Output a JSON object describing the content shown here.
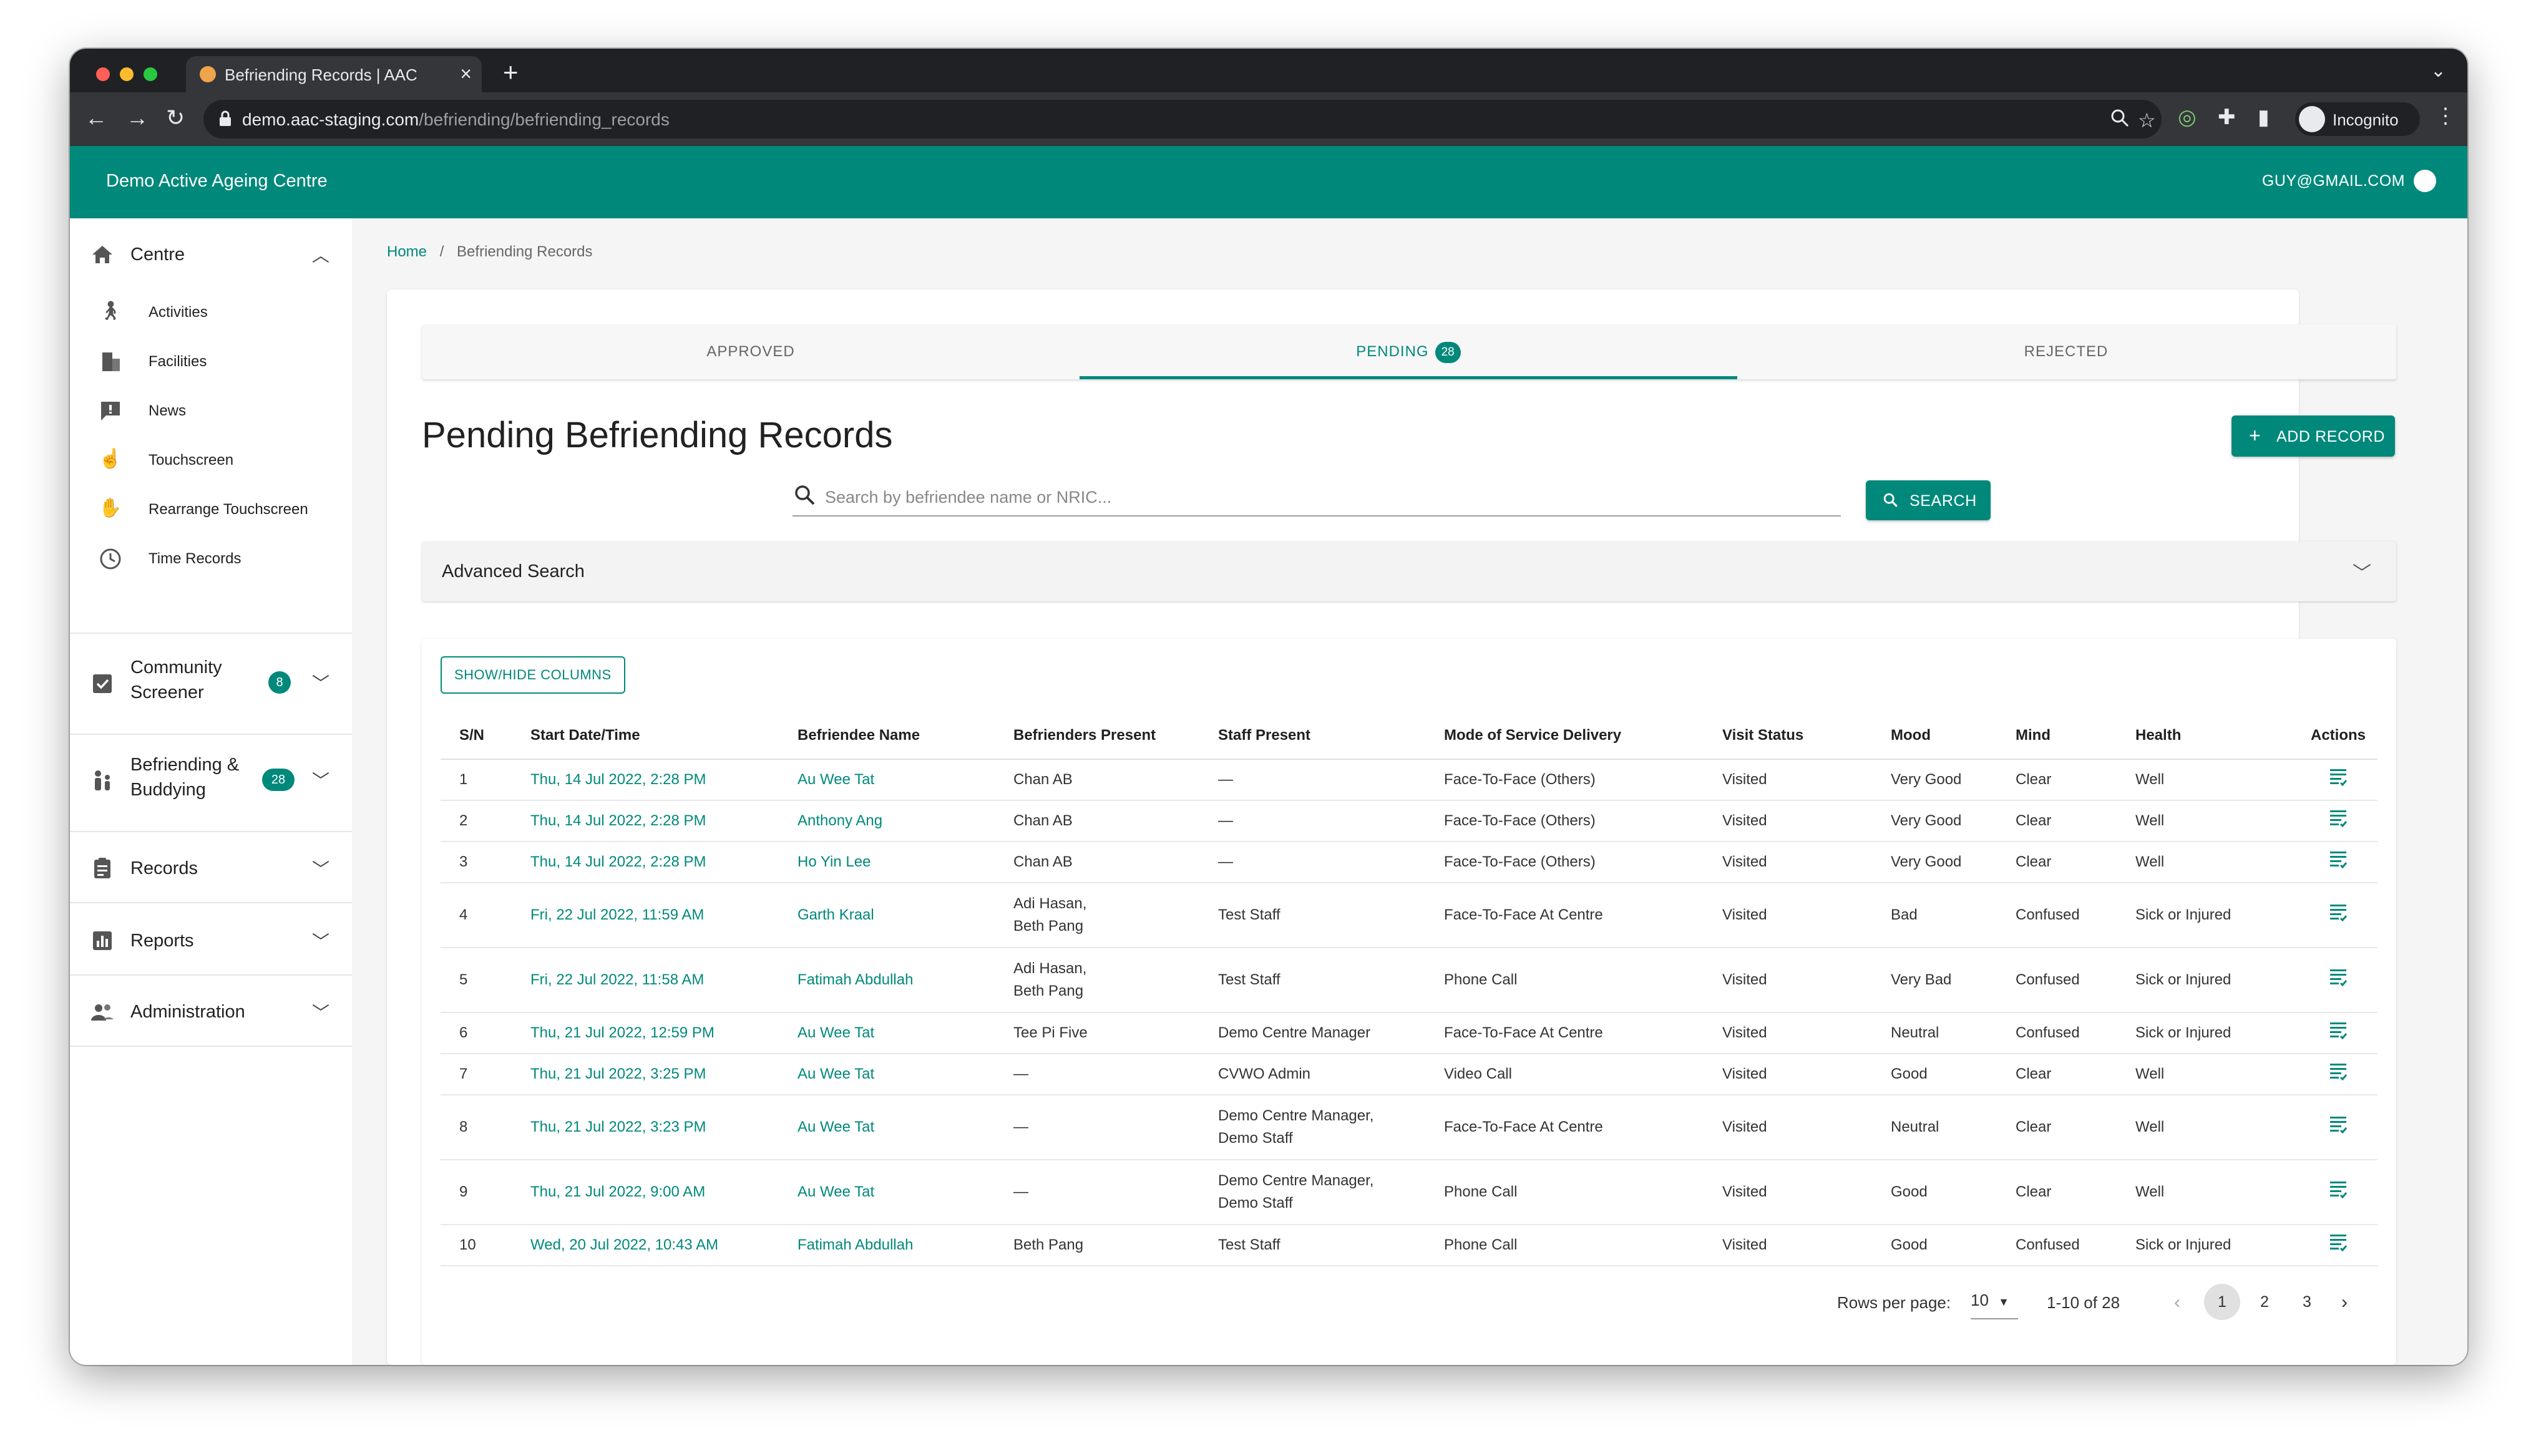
{
  "browser": {
    "tab_title": "Befriending Records | AAC",
    "url_host": "demo.aac-staging.com",
    "url_path": "/befriending/befriending_records",
    "profile_label": "Incognito"
  },
  "app": {
    "brand": "Demo Active Ageing Centre",
    "user_email": "GUY@GMAIL.COM"
  },
  "sidebar": {
    "centre_label": "Centre",
    "items": [
      "Activities",
      "Facilities",
      "News",
      "Touchscreen",
      "Rearrange Touchscreen",
      "Time Records"
    ],
    "community_label_1": "Community",
    "community_label_2": "Screener",
    "community_badge": "8",
    "befriending_label_1": "Befriending &",
    "befriending_label_2": "Buddying",
    "befriending_badge": "28",
    "records_label": "Records",
    "reports_label": "Reports",
    "admin_label": "Administration"
  },
  "breadcrumb": {
    "home": "Home",
    "sep": "/",
    "current": "Befriending Records"
  },
  "tabs": {
    "approved": "APPROVED",
    "pending": "PENDING",
    "pending_badge": "28",
    "rejected": "REJECTED"
  },
  "page": {
    "title": "Pending Befriending Records",
    "add_record": "ADD RECORD",
    "search_placeholder": "Search by befriendee name or NRIC...",
    "search_button": "SEARCH",
    "advanced_search": "Advanced Search",
    "show_hide": "SHOW/HIDE COLUMNS"
  },
  "table": {
    "headers": [
      "S/N",
      "Start Date/Time",
      "Befriendee Name",
      "Befrienders Present",
      "Staff Present",
      "Mode of Service Delivery",
      "Visit Status",
      "Mood",
      "Mind",
      "Health",
      "Actions"
    ],
    "rows": [
      {
        "sn": "1",
        "date": "Thu, 14 Jul 2022, 2:28 PM",
        "name": "Au Wee Tat",
        "befrienders": "Chan AB",
        "staff": "—",
        "mode": "Face-To-Face (Others)",
        "status": "Visited",
        "mood": "Very Good",
        "mind": "Clear",
        "health": "Well"
      },
      {
        "sn": "2",
        "date": "Thu, 14 Jul 2022, 2:28 PM",
        "name": "Anthony Ang",
        "befrienders": "Chan AB",
        "staff": "—",
        "mode": "Face-To-Face (Others)",
        "status": "Visited",
        "mood": "Very Good",
        "mind": "Clear",
        "health": "Well"
      },
      {
        "sn": "3",
        "date": "Thu, 14 Jul 2022, 2:28 PM",
        "name": "Ho Yin Lee",
        "befrienders": "Chan AB",
        "staff": "—",
        "mode": "Face-To-Face (Others)",
        "status": "Visited",
        "mood": "Very Good",
        "mind": "Clear",
        "health": "Well"
      },
      {
        "sn": "4",
        "date": "Fri, 22 Jul 2022, 11:59 AM",
        "name": "Garth Kraal",
        "befrienders_1": "Adi Hasan,",
        "befrienders_2": "Beth Pang",
        "staff": "Test Staff",
        "mode": "Face-To-Face At Centre",
        "status": "Visited",
        "mood": "Bad",
        "mind": "Confused",
        "health": "Sick or Injured"
      },
      {
        "sn": "5",
        "date": "Fri, 22 Jul 2022, 11:58 AM",
        "name": "Fatimah Abdullah",
        "befrienders_1": "Adi Hasan,",
        "befrienders_2": "Beth Pang",
        "staff": "Test Staff",
        "mode": "Phone Call",
        "status": "Visited",
        "mood": "Very Bad",
        "mind": "Confused",
        "health": "Sick or Injured"
      },
      {
        "sn": "6",
        "date": "Thu, 21 Jul 2022, 12:59 PM",
        "name": "Au Wee Tat",
        "befrienders": "Tee Pi Five",
        "staff": "Demo Centre Manager",
        "mode": "Face-To-Face At Centre",
        "status": "Visited",
        "mood": "Neutral",
        "mind": "Confused",
        "health": "Sick or Injured"
      },
      {
        "sn": "7",
        "date": "Thu, 21 Jul 2022, 3:25 PM",
        "name": "Au Wee Tat",
        "befrienders": "—",
        "staff": "CVWO Admin",
        "mode": "Video Call",
        "status": "Visited",
        "mood": "Good",
        "mind": "Clear",
        "health": "Well"
      },
      {
        "sn": "8",
        "date": "Thu, 21 Jul 2022, 3:23 PM",
        "name": "Au Wee Tat",
        "befrienders": "—",
        "staff_1": "Demo Centre Manager,",
        "staff_2": "Demo Staff",
        "mode": "Face-To-Face At Centre",
        "status": "Visited",
        "mood": "Neutral",
        "mind": "Clear",
        "health": "Well"
      },
      {
        "sn": "9",
        "date": "Thu, 21 Jul 2022, 9:00 AM",
        "name": "Au Wee Tat",
        "befrienders": "—",
        "staff_1": "Demo Centre Manager,",
        "staff_2": "Demo Staff",
        "mode": "Phone Call",
        "status": "Visited",
        "mood": "Good",
        "mind": "Clear",
        "health": "Well"
      },
      {
        "sn": "10",
        "date": "Wed, 20 Jul 2022, 10:43 AM",
        "name": "Fatimah Abdullah",
        "befrienders": "Beth Pang",
        "staff": "Test Staff",
        "mode": "Phone Call",
        "status": "Visited",
        "mood": "Good",
        "mind": "Confused",
        "health": "Sick or Injured"
      }
    ]
  },
  "pagination": {
    "rows_label": "Rows per page:",
    "rows_value": "10",
    "range": "1-10 of 28",
    "pages": [
      "1",
      "2",
      "3"
    ]
  },
  "colors": {
    "accent": "#00897b"
  }
}
